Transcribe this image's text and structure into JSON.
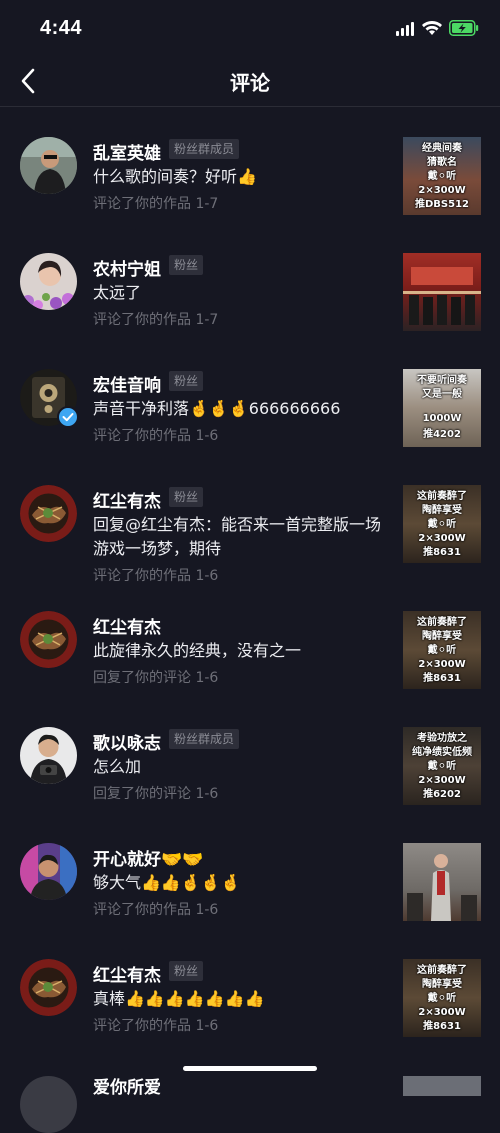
{
  "status_bar": {
    "time": "4:44"
  },
  "nav": {
    "title": "评论"
  },
  "comments": [
    {
      "name": "乱室英雄",
      "badge": "粉丝群成员",
      "text": "什么歌的间奏？好听👍",
      "meta": "评论了你的作品  1-7",
      "thumb_lines": [
        "经典间奏",
        "猜歌名",
        "戴⚪听",
        "2×300W",
        "推DBS512"
      ]
    },
    {
      "name": "农村宁姐",
      "badge": "粉丝",
      "text": "太远了",
      "meta": "评论了你的作品  1-7",
      "thumb_lines": []
    },
    {
      "name": "宏佳音响",
      "badge": "粉丝",
      "text": "声音干净利落🤞🤞🤞666666666",
      "meta": "评论了你的作品  1-6",
      "thumb_lines": [
        "不要听间奏",
        "又是一般",
        "1000W",
        "推4202"
      ]
    },
    {
      "name": "红尘有杰",
      "badge": "粉丝",
      "text": "回复@红尘有杰：能否来一首完整版一场游戏一场梦，期待",
      "meta": "评论了你的作品  1-6",
      "thumb_lines": [
        "这前奏醉了",
        "陶醉享受",
        "戴⚪听",
        "2×300W",
        "推8631"
      ]
    },
    {
      "name": "红尘有杰",
      "badge": "",
      "text": "此旋律永久的经典，没有之一",
      "meta": "回复了你的评论  1-6",
      "thumb_lines": [
        "这前奏醉了",
        "陶醉享受",
        "戴⚪听",
        "2×300W",
        "推8631"
      ]
    },
    {
      "name": "歌以咏志",
      "badge": "粉丝群成员",
      "text": "怎么加",
      "meta": "回复了你的评论  1-6",
      "thumb_lines": [
        "考验功放之",
        "纯净绩实低频",
        "戴⚪听",
        "2×300W",
        "推6202"
      ]
    },
    {
      "name": "开心就好🤝🤝",
      "badge": "",
      "text": "够大气👍👍🤞🤞🤞",
      "meta": "评论了你的作品  1-6",
      "thumb_lines": []
    },
    {
      "name": "红尘有杰",
      "badge": "粉丝",
      "text": "真棒👍👍👍👍👍👍👍",
      "meta": "评论了你的作品  1-6",
      "thumb_lines": [
        "这前奏醉了",
        "陶醉享受",
        "戴⚪听",
        "2×300W",
        "推8631"
      ]
    }
  ],
  "peek": {
    "name": "爱你所爱"
  }
}
